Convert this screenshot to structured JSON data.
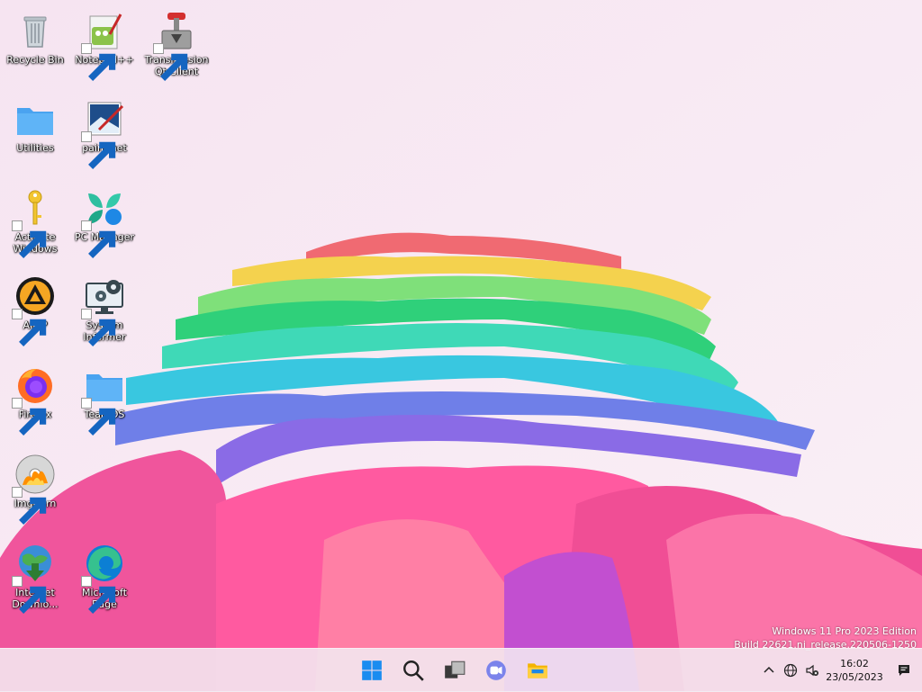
{
  "desktop": {
    "icons": [
      {
        "label": "Recycle Bin",
        "icon": "recycle-bin-icon"
      },
      {
        "label": "Notepad++",
        "icon": "notepadplusplus-icon"
      },
      {
        "label": "Transmission Qt Client",
        "icon": "transmission-icon"
      },
      {
        "label": "Utilities",
        "icon": "folder-icon"
      },
      {
        "label": "paint.net",
        "icon": "paintnet-icon"
      },
      {
        "label": "Activate Windows",
        "icon": "key-icon"
      },
      {
        "label": "PC Manager",
        "icon": "pc-manager-icon"
      },
      {
        "label": "AIMP",
        "icon": "aimp-icon"
      },
      {
        "label": "System Informer",
        "icon": "system-informer-icon"
      },
      {
        "label": "Firefox",
        "icon": "firefox-icon"
      },
      {
        "label": "TeamOS",
        "icon": "folder-icon"
      },
      {
        "label": "ImgBurn",
        "icon": "imgburn-icon"
      },
      {
        "label": "Internet Downlo...",
        "icon": "internet-download-manager-icon"
      },
      {
        "label": "Microsoft Edge",
        "icon": "edge-icon"
      }
    ]
  },
  "watermark": {
    "line1": "Windows 11 Pro 2023 Edition",
    "line2": "Build 22621.ni_release.220506-1250"
  },
  "taskbar": {
    "pinned": [
      "start-icon",
      "search-icon",
      "task-view-icon",
      "teams-chat-icon",
      "file-explorer-icon"
    ],
    "tray": {
      "time": "16:02",
      "date": "23/05/2023"
    }
  },
  "colors": {
    "wallpaper_bg": "#f7e9f4",
    "taskbar_bg": "#f3eaf1"
  }
}
